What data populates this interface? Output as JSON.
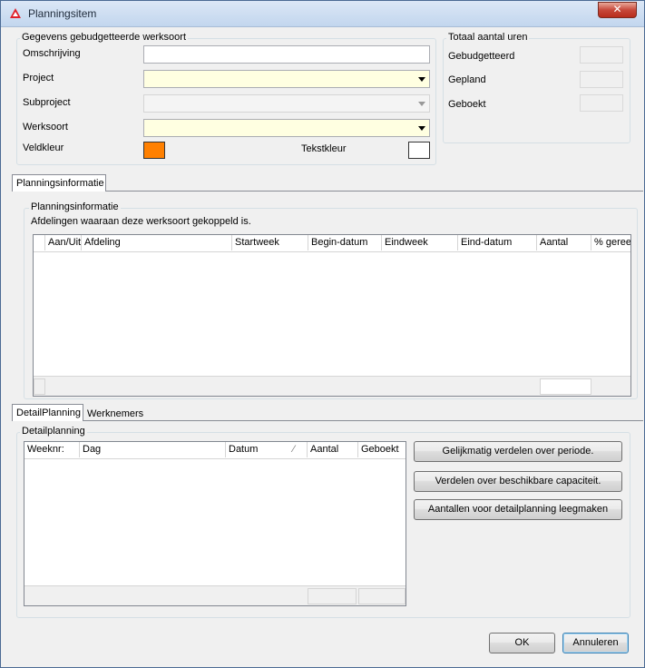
{
  "window": {
    "title": "Planningsitem",
    "close_glyph": "✕"
  },
  "budget_group": {
    "legend": "Gegevens gebudgetteerde werksoort",
    "omschrijving_label": "Omschrijving",
    "omschrijving_value": "",
    "project_label": "Project",
    "project_value": "",
    "subproject_label": "Subproject",
    "subproject_value": "",
    "werksoort_label": "Werksoort",
    "werksoort_value": "",
    "veldkleur_label": "Veldkleur",
    "veldkleur_color": "#ff8000",
    "tekstkleur_label": "Tekstkleur",
    "tekstkleur_color": "#ffffff"
  },
  "totals_group": {
    "legend": "Totaal aantal uren",
    "gebudgetteerd_label": "Gebudgetteerd",
    "gepland_label": "Gepland",
    "geboekt_label": "Geboekt"
  },
  "tabs_top": [
    {
      "label": "Planningsinformatie",
      "active": true
    }
  ],
  "planning_info": {
    "legend": "Planningsinformatie",
    "description": "Afdelingen waaraan deze werksoort gekoppeld is.",
    "columns": [
      "",
      "Aan/Uit",
      "Afdeling",
      "Startweek",
      "Begin-datum",
      "Eindweek",
      "Eind-datum",
      "Aantal",
      "% gereed"
    ]
  },
  "tabs_bottom": [
    {
      "label": "DetailPlanning",
      "active": true
    },
    {
      "label": "Werknemers",
      "active": false
    }
  ],
  "detail": {
    "legend": "Detailplanning",
    "columns": [
      "Weeknr:",
      "Dag",
      "Datum",
      "Aantal",
      "Geboekt"
    ],
    "sort_indicator": "⁄",
    "buttons": {
      "distribute_period": "Gelijkmatig verdelen over periode.",
      "distribute_capacity": "Verdelen over beschikbare capaciteit.",
      "clear": "Aantallen voor detailplanning leegmaken"
    }
  },
  "footer": {
    "ok": "OK",
    "cancel": "Annuleren"
  }
}
